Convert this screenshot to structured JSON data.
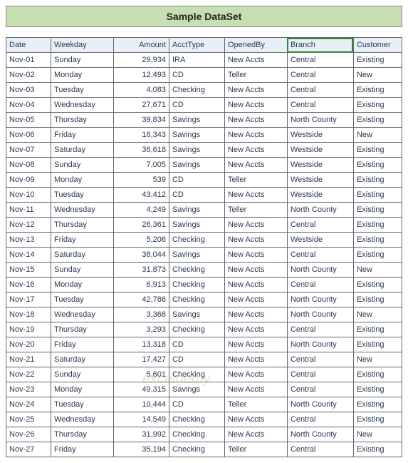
{
  "title": "Sample DataSet",
  "columns": [
    "Date",
    "Weekday",
    "Amount",
    "AcctType",
    "OpenedBy",
    "Branch",
    "Customer"
  ],
  "selected_column_index": 5,
  "watermark": "exceldemy",
  "chart_data": {
    "type": "table",
    "title": "Sample DataSet",
    "columns": [
      "Date",
      "Weekday",
      "Amount",
      "AcctType",
      "OpenedBy",
      "Branch",
      "Customer"
    ],
    "rows": [
      [
        "Nov-01",
        "Sunday",
        "29,934",
        "IRA",
        "New Accts",
        "Central",
        "Existing"
      ],
      [
        "Nov-02",
        "Monday",
        "12,493",
        "CD",
        "Teller",
        "Central",
        "New"
      ],
      [
        "Nov-03",
        "Tuesday",
        "4,083",
        "Checking",
        "New Accts",
        "Central",
        "Existing"
      ],
      [
        "Nov-04",
        "Wednesday",
        "27,671",
        "CD",
        "New Accts",
        "Central",
        "Existing"
      ],
      [
        "Nov-05",
        "Thursday",
        "39,834",
        "Savings",
        "New Accts",
        "North County",
        "Existing"
      ],
      [
        "Nov-06",
        "Friday",
        "16,343",
        "Savings",
        "New Accts",
        "Westside",
        "New"
      ],
      [
        "Nov-07",
        "Saturday",
        "36,618",
        "Savings",
        "New Accts",
        "Westside",
        "Existing"
      ],
      [
        "Nov-08",
        "Sunday",
        "7,005",
        "Savings",
        "New Accts",
        "Westside",
        "Existing"
      ],
      [
        "Nov-09",
        "Monday",
        "539",
        "CD",
        "Teller",
        "Westside",
        "Existing"
      ],
      [
        "Nov-10",
        "Tuesday",
        "43,412",
        "CD",
        "New Accts",
        "Westside",
        "Existing"
      ],
      [
        "Nov-11",
        "Wednesday",
        "4,249",
        "Savings",
        "Teller",
        "North County",
        "Existing"
      ],
      [
        "Nov-12",
        "Thursday",
        "26,361",
        "Savings",
        "New Accts",
        "Central",
        "Existing"
      ],
      [
        "Nov-13",
        "Friday",
        "5,206",
        "Checking",
        "New Accts",
        "Westside",
        "Existing"
      ],
      [
        "Nov-14",
        "Saturday",
        "38,044",
        "Savings",
        "New Accts",
        "Central",
        "Existing"
      ],
      [
        "Nov-15",
        "Sunday",
        "31,873",
        "Checking",
        "New Accts",
        "North County",
        "New"
      ],
      [
        "Nov-16",
        "Monday",
        "6,913",
        "Checking",
        "New Accts",
        "Central",
        "Existing"
      ],
      [
        "Nov-17",
        "Tuesday",
        "42,786",
        "Checking",
        "New Accts",
        "North County",
        "Existing"
      ],
      [
        "Nov-18",
        "Wednesday",
        "3,368",
        "Savings",
        "New Accts",
        "North County",
        "New"
      ],
      [
        "Nov-19",
        "Thursday",
        "3,293",
        "Checking",
        "New Accts",
        "Central",
        "Existing"
      ],
      [
        "Nov-20",
        "Friday",
        "13,318",
        "CD",
        "New Accts",
        "North County",
        "Existing"
      ],
      [
        "Nov-21",
        "Saturday",
        "17,427",
        "CD",
        "New Accts",
        "Central",
        "New"
      ],
      [
        "Nov-22",
        "Sunday",
        "5,601",
        "Checking",
        "New Accts",
        "Central",
        "Existing"
      ],
      [
        "Nov-23",
        "Monday",
        "49,315",
        "Savings",
        "New Accts",
        "Central",
        "Existing"
      ],
      [
        "Nov-24",
        "Tuesday",
        "10,444",
        "CD",
        "Teller",
        "North County",
        "Existing"
      ],
      [
        "Nov-25",
        "Wednesday",
        "14,549",
        "Checking",
        "New Accts",
        "Central",
        "Existing"
      ],
      [
        "Nov-26",
        "Thursday",
        "31,992",
        "Checking",
        "New Accts",
        "North County",
        "New"
      ],
      [
        "Nov-27",
        "Friday",
        "35,194",
        "Checking",
        "Teller",
        "Central",
        "Existing"
      ]
    ]
  }
}
